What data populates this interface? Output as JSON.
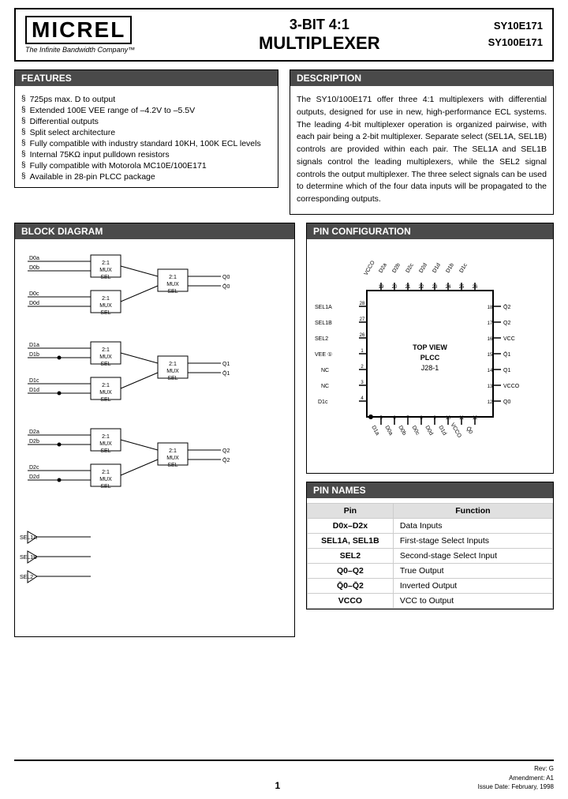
{
  "header": {
    "logo": "MICREL",
    "logo_subtitle": "The Infinite Bandwidth Company™",
    "product_line1": "3-BIT 4:1",
    "product_line2": "MULTIPLEXER",
    "part1": "SY10E171",
    "part2": "SY100E171"
  },
  "features": {
    "title": "FEATURES",
    "items": [
      "725ps max. D to output",
      "Extended 100E VEE range of –4.2V to –5.5V",
      "Differential outputs",
      "Split select architecture",
      "Fully compatible with industry standard 10KH, 100K ECL levels",
      "Internal 75KΩ input pulldown resistors",
      "Fully compatible with Motorola MC10E/100E171",
      "Available in 28-pin PLCC package"
    ]
  },
  "description": {
    "title": "DESCRIPTION",
    "text": "The SY10/100E171 offer three 4:1 multiplexers with differential outputs, designed for use in new, high-performance ECL systems. The leading 4-bit multiplexer operation is organized pairwise, with each pair being a 2-bit multiplexer. Separate select (SEL1A, SEL1B) controls are provided within each pair. The SEL1A and SEL1B signals control the leading multiplexers, while the SEL2 signal controls the output multiplexer. The three select signals can be used to determine which of the four data inputs will be propagated to the corresponding outputs."
  },
  "block_diagram": {
    "title": "BLOCK DIAGRAM"
  },
  "pin_config": {
    "title": "PIN CONFIGURATION"
  },
  "pin_names": {
    "title": "PIN NAMES",
    "col1": "Pin",
    "col2": "Function",
    "rows": [
      {
        "pin": "D0x–D2x",
        "function": "Data Inputs"
      },
      {
        "pin": "SEL1A, SEL1B",
        "function": "First-stage Select Inputs"
      },
      {
        "pin": "SEL2",
        "function": "Second-stage Select Input"
      },
      {
        "pin": "Q0–Q2",
        "function": "True Output"
      },
      {
        "pin": "Q̄0–Q̄2",
        "function": "Inverted Output"
      },
      {
        "pin": "VCCO",
        "function": "VCC to Output"
      }
    ]
  },
  "footer": {
    "page": "1",
    "rev": "Rev: G",
    "amendment": "Amendment: A1",
    "issue_date": "Issue Date: February, 1998"
  }
}
